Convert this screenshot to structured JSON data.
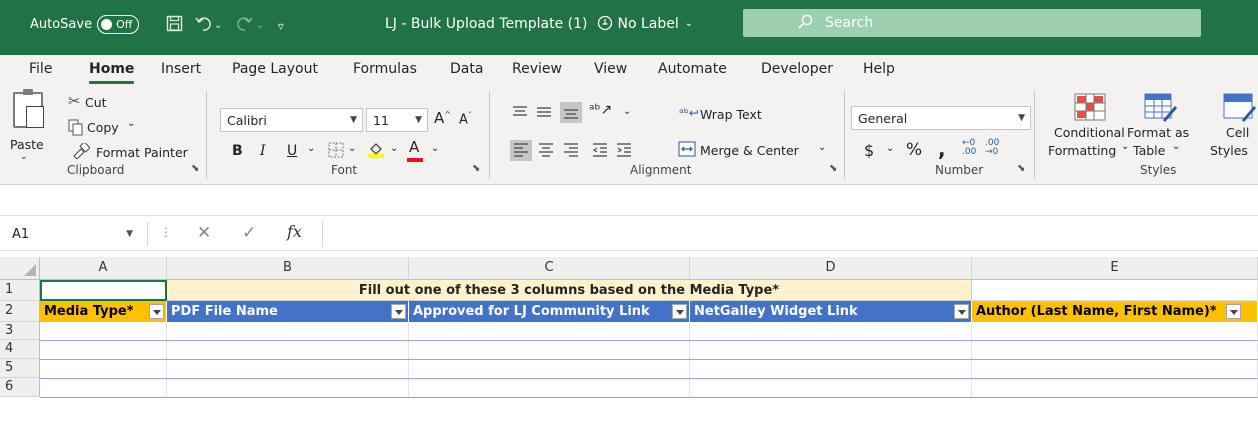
{
  "title_bar": {
    "autosave_label": "AutoSave",
    "autosave_state": "Off",
    "document_title": "LJ - Bulk Upload Template (1)",
    "sensitivity_label": "No Label",
    "search_placeholder": "Search"
  },
  "menu_tabs": [
    "File",
    "Home",
    "Insert",
    "Page Layout",
    "Formulas",
    "Data",
    "Review",
    "View",
    "Automate",
    "Developer",
    "Help"
  ],
  "active_tab": "Home",
  "ribbon": {
    "clipboard": {
      "label": "Clipboard",
      "paste": "Paste",
      "cut": "Cut",
      "copy": "Copy",
      "format_painter": "Format Painter"
    },
    "font": {
      "label": "Font",
      "font_name": "Calibri",
      "font_size": "11"
    },
    "alignment": {
      "label": "Alignment",
      "wrap_text": "Wrap Text",
      "merge_center": "Merge & Center"
    },
    "number": {
      "label": "Number",
      "format": "General"
    },
    "styles": {
      "label": "Styles",
      "conditional_1": "Conditional",
      "conditional_2": "Formatting",
      "format_table_1": "Format as",
      "format_table_2": "Table",
      "cell_styles_1": "Cell",
      "cell_styles_2": "Styles"
    }
  },
  "formula_bar": {
    "name_box": "A1",
    "fx": "fx",
    "formula": ""
  },
  "grid": {
    "columns": [
      "A",
      "B",
      "C",
      "D",
      "E"
    ],
    "rows": [
      "1",
      "2",
      "3",
      "4",
      "5",
      "6"
    ],
    "merged_note": "Fill out one of these 3 columns based on the Media Type*",
    "headers": [
      "Media Type*",
      "PDF File Name",
      "Approved for LJ Community Link",
      "NetGalley Widget Link",
      "Author (Last Name, First Name)*"
    ]
  },
  "colors": {
    "title_bar": "#217346",
    "search_box": "#9dd0b0",
    "header_blue": "#4472c4",
    "header_gold": "#ffc000",
    "note_fill": "#fff2cc",
    "font_highlight": "#ffff00",
    "font_color": "#e81123"
  }
}
